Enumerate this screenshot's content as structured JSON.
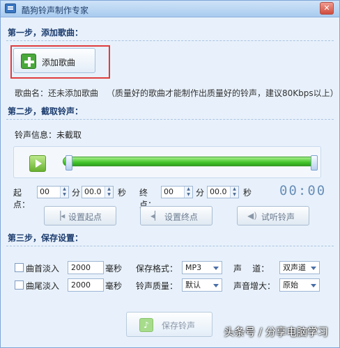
{
  "window": {
    "title": "酷狗铃声制作专家",
    "close": "✕"
  },
  "step1": {
    "header": "第一步，添加歌曲：",
    "add_song_button": "添加歌曲",
    "song_name_label": "歌曲名：还未添加歌曲",
    "hint": "（质量好的歌曲才能制作出质量好的铃声，建议80Kbps以上）"
  },
  "step2": {
    "header": "第二步，截取铃声：",
    "info_label": "铃声信息：未截取",
    "start_label": "起点：",
    "end_label": "终点：",
    "start_minutes": "00",
    "start_seconds": "00.0",
    "end_minutes": "00",
    "end_seconds": "00.0",
    "minute_unit": "分",
    "second_unit": "秒",
    "time_display": "00:00",
    "buttons": {
      "set_start": "设置起点",
      "set_end": "设置终点",
      "preview": "试听铃声"
    }
  },
  "step3": {
    "header": "第三步，保存设置：",
    "fade_in": {
      "label": "曲首淡入",
      "value": "2000",
      "unit": "毫秒"
    },
    "fade_out": {
      "label": "曲尾淡入",
      "value": "2000",
      "unit": "毫秒"
    },
    "format": {
      "label": "保存格式：",
      "value": "MP3"
    },
    "quality": {
      "label": "铃声质量：",
      "value": "默认"
    },
    "channel": {
      "label": "声    道：",
      "value": "双声道"
    },
    "gain": {
      "label": "声音增大：",
      "value": "原始"
    },
    "save_button": "保存铃声"
  },
  "watermark": "头条号 / 分享电脑学习",
  "colors": {
    "accent": "#2e9f1f",
    "highlight": "#e03c3c",
    "title_bg": "#a9cbef"
  }
}
